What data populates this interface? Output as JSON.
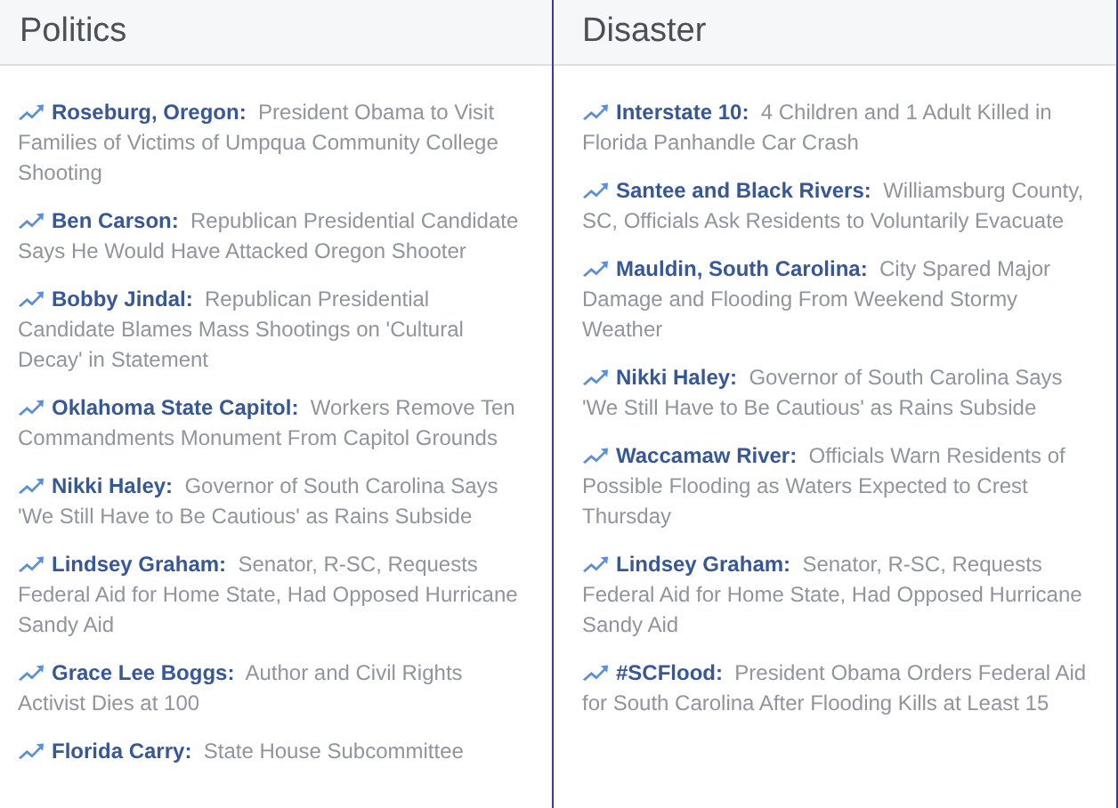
{
  "columns": [
    {
      "title": "Politics",
      "items": [
        {
          "topic": "Roseburg, Oregon:",
          "headline": "President Obama to Visit Families of Victims of Umpqua Community College Shooting"
        },
        {
          "topic": "Ben Carson:",
          "headline": "Republican Presidential Candidate Says He Would Have Attacked Oregon Shooter"
        },
        {
          "topic": "Bobby Jindal:",
          "headline": "Republican Presidential Candidate Blames Mass Shootings on 'Cultural Decay' in Statement"
        },
        {
          "topic": "Oklahoma State Capitol:",
          "headline": "Workers Remove Ten Commandments Monument From Capitol Grounds"
        },
        {
          "topic": "Nikki Haley:",
          "headline": "Governor of South Carolina Says 'We Still Have to Be Cautious' as Rains Subside"
        },
        {
          "topic": "Lindsey Graham:",
          "headline": "Senator, R-SC, Requests Federal Aid for Home State, Had Opposed Hurricane Sandy Aid"
        },
        {
          "topic": "Grace Lee Boggs:",
          "headline": "Author and Civil Rights Activist Dies at 100"
        },
        {
          "topic": "Florida Carry:",
          "headline": "State House Subcommittee"
        }
      ]
    },
    {
      "title": "Disaster",
      "items": [
        {
          "topic": "Interstate 10:",
          "headline": "4 Children and 1 Adult Killed in Florida Panhandle Car Crash"
        },
        {
          "topic": "Santee and Black Rivers:",
          "headline": "Williamsburg County, SC, Officials Ask Residents to Voluntarily Evacuate"
        },
        {
          "topic": "Mauldin, South Carolina:",
          "headline": "City Spared Major Damage and Flooding From Weekend Stormy Weather"
        },
        {
          "topic": "Nikki Haley:",
          "headline": "Governor of South Carolina Says 'We Still Have to Be Cautious' as Rains Subside"
        },
        {
          "topic": "Waccamaw River:",
          "headline": "Officials Warn Residents of Possible Flooding as Waters Expected to Crest Thursday"
        },
        {
          "topic": "Lindsey Graham:",
          "headline": "Senator, R-SC, Requests Federal Aid for Home State, Had Opposed Hurricane Sandy Aid"
        },
        {
          "topic": "#SCFlood:",
          "headline": "President Obama Orders Federal Aid for South Carolina After Flooding Kills at Least 15"
        }
      ]
    }
  ]
}
